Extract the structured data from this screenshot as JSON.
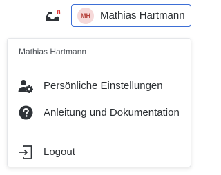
{
  "header": {
    "inbox": {
      "icon": "inbox-tray-icon",
      "badge": "8",
      "badge_color": "#e03030"
    },
    "user": {
      "initials": "MH",
      "name": "Mathias Hartmann",
      "accent": "#3d6fd6"
    }
  },
  "menu": {
    "title": "Mathias Hartmann",
    "items": [
      {
        "label": "Persönliche Einstellungen",
        "icon": "user-cog-icon"
      },
      {
        "label": "Anleitung und Dokumentation",
        "icon": "help-circle-icon"
      },
      {
        "label": "Logout",
        "icon": "logout-icon"
      }
    ]
  }
}
